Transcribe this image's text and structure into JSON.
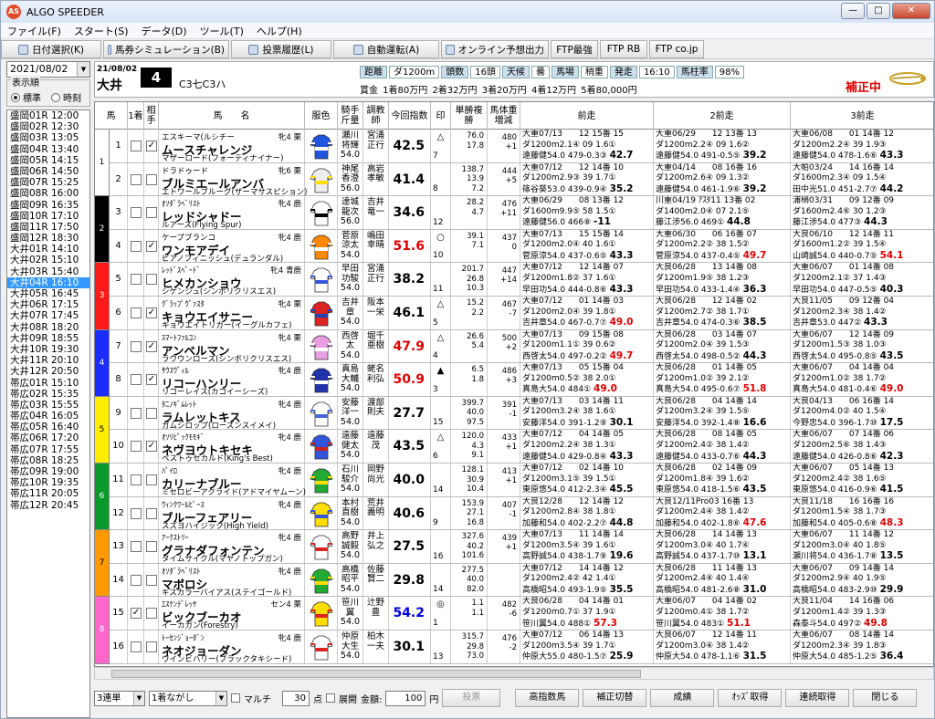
{
  "window": {
    "title": "ALGO SPEEDER",
    "icon_text": "AS"
  },
  "menu": [
    "ファイル(F)",
    "スタート(S)",
    "データ(D)",
    "ツール(T)",
    "ヘルプ(H)"
  ],
  "toolbar": [
    "日付選択(K)",
    "馬券シミュレーション(B)",
    "投票履歴(L)",
    "自動運転(A)",
    "オンライン予想出力",
    "FTP最強",
    "FTP RB",
    "FTP co.jp"
  ],
  "left": {
    "date": "2021/08/02",
    "order_label": "表示順",
    "radio_std": "標準",
    "radio_time": "時刻",
    "races": [
      "盛岡01R 12:00",
      "盛岡02R 12:30",
      "盛岡03R 13:05",
      "盛岡04R 13:40",
      "盛岡05R 14:15",
      "盛岡06R 14:50",
      "盛岡07R 15:25",
      "盛岡08R 16:00",
      "盛岡09R 16:35",
      "盛岡10R 17:10",
      "盛岡11R 17:50",
      "盛岡12R 18:30",
      "大井01R 14:10",
      "大井02R 15:10",
      "大井03R 15:40",
      "大井04R 16:10",
      "大井05R 16:45",
      "大井06R 17:15",
      "大井07R 17:45",
      "大井08R 18:20",
      "大井09R 18:55",
      "大井10R 19:30",
      "大井11R 20:10",
      "大井12R 20:50",
      "帯広01R 15:10",
      "帯広02R 15:35",
      "帯広03R 15:55",
      "帯広04R 16:05",
      "帯広05R 16:40",
      "帯広06R 17:20",
      "帯広07R 17:55",
      "帯広08R 18:25",
      "帯広09R 19:00",
      "帯広10R 19:35",
      "帯広11R 20:05",
      "帯広12R 20:45"
    ],
    "selected_index": 15
  },
  "race": {
    "date": "21/08/02",
    "place": "大井",
    "number": "4",
    "class": "C3七C3ハ",
    "info": [
      [
        "距離",
        "ダ1200m"
      ],
      [
        "頭数",
        "16頭"
      ],
      [
        "天候",
        "曇"
      ],
      [
        "馬場",
        "稍重"
      ],
      [
        "発走",
        "16:10"
      ],
      [
        "馬柱率",
        "98%"
      ]
    ],
    "prize": "賞金 1着80万円 2着32万円 3着20万円 4着12万円 5着80,000円",
    "correction": "補正中"
  },
  "columns": [
    "馬",
    "1着",
    "相手",
    "馬　　名",
    "服色",
    "騎手斤量",
    "調教師",
    "今回指数",
    "印",
    "単勝複勝",
    "馬体重増減",
    "前走",
    "2前走",
    "3前走"
  ],
  "horses": [
    {
      "no": "1",
      "win": false,
      "mate": true,
      "pre": "エスキーマ(ルシチー",
      "sx": "牝4 栗",
      "name": "ムースチャレンジ",
      "dam": "マザーロード(フォーティナイナー)",
      "jockey": "瀬川\n将輝\n54.0",
      "trainer": "宮涌\n正行",
      "index": "42.5",
      "ic": "",
      "mark": "△",
      "mark2": "7",
      "odds": "76.0\n17.8",
      "wt": "480\n+1",
      "p1": [
        "大重07/13　　12 15番 15",
        "ダ1200m2.1④ 09 1.6①",
        "遠藤健54.0 479-0.3③ 42.7"
      ],
      "p2": [
        "大重06/29　　12 13番 13",
        "ダ1200m2.2④ 09 1.6②",
        "遠藤健54.0 491-0.5⑤ 39.2"
      ],
      "p3": [
        "大重06/08　　01 14番 12",
        "ダ1200m2.2④ 39 1.9③",
        "遠藤健54.0 478-1.6⑥ 43.3"
      ]
    },
    {
      "no": "2",
      "win": false,
      "mate": false,
      "pre": "ドラドゥード",
      "sx": "牝6 栗",
      "name": "ブルミエールアンバ",
      "dam": "エトワールブルーグ(ザーマサスピション)",
      "jockey": "神尾\n香澄\n56.0",
      "trainer": "高岩\n孝敏",
      "index": "41.4",
      "ic": "",
      "mark": "",
      "mark2": "8",
      "odds": "138.7\n13.9\n7.2",
      "wt": "444\n+5",
      "p1": [
        "大重07/12　　12 14番 10",
        "ダ1200m2.9③ 39 1.7①",
        "篠谷葵53.0 439-0.9④ 35.2"
      ],
      "p2": [
        "大重04/14　　08 16番 16",
        "ダ1200m2.6④ 09 1.3②",
        "遠藤健54.0 461-1.9⑥ 39.2"
      ],
      "p3": [
        "大帕03/24　　14 16番 14",
        "ダ1600m2.3④ 09 1.5④",
        "田中光51.0 451-2.7⑦ 44.2"
      ]
    },
    {
      "no": "3",
      "win": false,
      "mate": false,
      "pre": "ｵｿﾀﾞﾗﾍﾞﾘｽﾄ",
      "sx": "牝4 鹿",
      "name": "レッドシャドー",
      "dam": "ルアーズ(Flying Spur)",
      "jockey": "達城\n龍次\n56.0",
      "trainer": "吉井\n竜一",
      "index": "34.6",
      "ic": "",
      "mark": "",
      "mark2": "12",
      "odds": "28.2\n4.7",
      "wt": "476\n+11",
      "p1": [
        "大重06/29　　08 13番 12",
        "ダ1600m9.9⑤ 58 1.5①",
        "遠藤健56.0 466⑧ -11"
      ],
      "p2": [
        "川重04/19 ｱｽﾀ11 13番 02",
        "ダ1400m2.0④ 07 2.1⑤",
        "藤江渉56.0 469① 44.8"
      ],
      "p3": [
        "浦稍03/31　　09 12番 09",
        "ダ1600m2.4⑥ 30 1.2③",
        "藤江渉54.0 477③ 44.3"
      ]
    },
    {
      "no": "4",
      "win": false,
      "mate": true,
      "pre": "ケープブランコ",
      "sx": "牝4 鹿",
      "name": "ワンモアデイ",
      "dam": "ビアノフィニッシュ(デュランダル)",
      "jockey": "菅原\n涼太\n54.0",
      "trainer": "嶋田\n幸晴",
      "index": "51.6",
      "ic": "red",
      "mark": "○",
      "mark2": "10",
      "odds": "39.1\n7.1",
      "wt": "437\n0",
      "p1": [
        "大重07/13　　15 15番 14",
        "ダ1200m2.0④ 40 1.6①",
        "菅原涼54.0 437-0.6⑤ 43.3"
      ],
      "p2": [
        "大重06/30　　06 16番 07",
        "ダ1200m2.2② 38 1.5②",
        "菅原涼54.0 437-0.4⑤ 49.7"
      ],
      "p3": [
        "大良06/10　　12 14番 11",
        "ダ1600m1.2② 39 1.5④",
        "山崎誠54.0 440-0.7⑤ 54.1"
      ]
    },
    {
      "no": "5",
      "win": false,
      "mate": false,
      "pre": "ﾚｯﾄﾞｽﾍﾟｰﾄﾞ",
      "sx": "牝4 青鹿",
      "name": "ヒメカンショウ",
      "dam": "シゲンジュ(シンボリクリスエス)",
      "jockey": "早田\n功駿\n54.0",
      "trainer": "宮涌\n正行",
      "index": "38.2",
      "ic": "",
      "mark": "",
      "mark2": "11",
      "odds": "201.7\n26.8\n10.3",
      "wt": "447\n+14",
      "p1": [
        "大重07/12　　12 14番 07",
        "ダ1200m1.8② 37 1.6①",
        "早田功54.0 444-0.8⑥ 43.3"
      ],
      "p2": [
        "大良06/28　　13 14番 08",
        "ダ1200m1.9⑤ 38 1.2③",
        "早田功54.0 433-1.4④ 36.3"
      ],
      "p3": [
        "大重06/07　　01 14番 08",
        "ダ1200m2.1② 37 1.4③",
        "早田功54.0 447-0.5⑤ 40.3"
      ]
    },
    {
      "no": "6",
      "win": false,
      "mate": true,
      "pre": "ｸﾞﾗｯﾌﾟｳﾞｧｽﾀ",
      "sx": "牝4 栗",
      "name": "キョウエイサニー",
      "dam": "キョウエイトリガー(イーグルカフェ)",
      "jockey": "吉井\n章\n54.0",
      "trainer": "阪本\n一栄",
      "index": "46.1",
      "ic": "",
      "mark": "△",
      "mark2": "5",
      "odds": "15.2\n2.2",
      "wt": "467\n-7",
      "p1": [
        "大重07/12　　01 14番 03",
        "ダ1200m2.0④ 39 1.8①",
        "吉井章54.0 467-0.7⑦ 49.0"
      ],
      "p2": [
        "大良06/28　　12 14番 02",
        "ダ1200m2.7② 38 1.7①",
        "吉井章54.0 474-0.3⑥ 38.5"
      ],
      "p3": [
        "大良11/05　　09 12番 04",
        "ダ1200m2.3④ 38 1.4②",
        "吉井章53.0 447② 43.3"
      ]
    },
    {
      "no": "7",
      "win": false,
      "mate": true,
      "pre": "ｽﾏｰﾄﾌｧﾙｺﾝ",
      "sx": "牝4 栗",
      "name": "アンベルマン",
      "dam": "ラウウンローズ(シンボリクリスエス)",
      "jockey": "西啓\n太\n54.0",
      "trainer": "堀千\n亜樹",
      "index": "47.9",
      "ic": "red",
      "mark": "△",
      "mark2": "4",
      "odds": "26.6\n5.4",
      "wt": "500\n+2",
      "p1": [
        "大重07/13　　09 15番 08",
        "ダ1200m1.1① 39 0.6②",
        "西啓太54.0 497-0.2② 49.7"
      ],
      "p2": [
        "大良06/28　　03 14番 07",
        "ダ1200m2.0④ 39 1.5③",
        "西啓太54.0 498-0.5② 44.3"
      ],
      "p3": [
        "大重06/07　　12 14番 09",
        "ダ1200m1.5③ 38 1.0③",
        "西啓太54.0 495-0.8⑤ 43.5"
      ]
    },
    {
      "no": "8",
      "win": false,
      "mate": true,
      "pre": "ｻｳｽｳﾞｨﾙ",
      "sx": "牝4 鹿",
      "name": "リコーハンリー",
      "dam": "リコーレイス(カコイーシーズ)",
      "jockey": "真島\n大輔\n54.0",
      "trainer": "蛯名\n利弘",
      "index": "50.9",
      "ic": "red",
      "mark": "▲",
      "mark2": "3",
      "odds": "6.5\n1.8",
      "wt": "486\n+3",
      "p1": [
        "大重07/13　　05 15番 04",
        "ダ1200m0.5② 38 2.0①",
        "真島大54.0 484① 49.0"
      ],
      "p2": [
        "大良06/28　　01 14番 05",
        "ダ1200m1.0② 39 2.1②",
        "真島大54.0 495-0.6⑦ 51.8"
      ],
      "p3": [
        "大重06/07　　04 14番 04",
        "ダ1200m1.0② 38 1.7②",
        "真島大54.0 481-0.4⑥ 49.0"
      ]
    },
    {
      "no": "9",
      "win": false,
      "mate": false,
      "pre": "ﾀﾆﾉｷﾞﾑﾚｯﾄ",
      "sx": "牝4 鹿",
      "name": "ラムレットキス",
      "dam": "ガムシロップ(ローズンスイメイ)",
      "jockey": "安藤\n洋一\n54.0",
      "trainer": "渡部\n則夫",
      "index": "27.7",
      "ic": "",
      "mark": "",
      "mark2": "15",
      "odds": "399.7\n40.0\n97.5",
      "wt": "391\n-1",
      "p1": [
        "大重07/13　　03 14番 11",
        "ダ1200m3.2④ 38 1.6①",
        "安藤洋54.0 391-1.2⑨ 30.1"
      ],
      "p2": [
        "大良06/28　　04 14番 14",
        "ダ1200m3.2④ 39 1.5⑤",
        "安藤洋54.0 392-1.4⑧ 16.6"
      ],
      "p3": [
        "大良04/13　　06 16番 14",
        "ダ1200m4.0② 40 1.5④",
        "今野忠54.0 396-1.7⑩ 17.5"
      ]
    },
    {
      "no": "10",
      "win": false,
      "mate": true,
      "pre": "ｵｿﾘﾋﾟｯｸﾓﾓｷﾞ",
      "sx": "牝4 鹿",
      "name": "ネヴヨウトキセキ",
      "dam": "ベストゥセカルド(King's Best)",
      "jockey": "遠藤\n健太\n54.0",
      "trainer": "遠藤\n茂",
      "index": "43.5",
      "ic": "",
      "mark": "△",
      "mark2": "6",
      "odds": "120.0\n4.3\n9.1",
      "wt": "433\n+1",
      "p1": [
        "大重07/12　　04 14番 05",
        "ダ1200m2.2④ 38 1.3①",
        "遠藤健54.0 429-0.8④ 43.3"
      ],
      "p2": [
        "大良06/28　　08 14番 05",
        "ダ1200m2.4② 38 1.4②",
        "遠藤健54.0 433-0.7⑥ 44.3"
      ],
      "p3": [
        "大重06/07　　07 14番 06",
        "ダ1200m2.5⑥ 38 1.4③",
        "遠藤健54.0 426-0.8⑥ 42.3"
      ]
    },
    {
      "no": "11",
      "win": false,
      "mate": false,
      "pre": "ﾊﾟｲﾛ",
      "sx": "牝4 鹿",
      "name": "カリーナブルー",
      "dam": "ミセロビーアクライド(アドマイヤムーン)",
      "jockey": "石川\n駿介\n54.0",
      "trainer": "岡野\n尚光",
      "index": "40.0",
      "ic": "",
      "mark": "",
      "mark2": "14",
      "odds": "128.1\n30.9\n10.4",
      "wt": "413\n+1",
      "p1": [
        "大重07/12　　02 14番 10",
        "ダ1200m3.1⑤ 39 1.5①",
        "東原悠54.0 412-2.3④ 45.5"
      ],
      "p2": [
        "大良06/28　　02 14番 09",
        "ダ1200m1.8④ 39 1.6②",
        "東原悠54.0 418-1.5⑥ 43.5"
      ],
      "p3": [
        "大重06/07　　05 14番 13",
        "ダ1200m2.4② 38 1.6⑤",
        "東原悠54.0 416-0.9⑥ 41.5"
      ]
    },
    {
      "no": "12",
      "win": false,
      "mate": false,
      "pre": "ｳｨﾝｸﾜｰﾙﾋﾟｰｽ",
      "sx": "牝4 鹿",
      "name": "ブルーフェアリー",
      "dam": "スズヨハイジック(High Yield)",
      "jockey": "本村\n直樹\n54.0",
      "trainer": "荒井\n義明",
      "index": "40.6",
      "ic": "",
      "mark": "",
      "mark2": "9",
      "odds": "153.9\n27.1\n16.8",
      "wt": "407\n-1",
      "p1": [
        "大良12/28　　12 14番 12",
        "ダ1200m2.8④ 38 1.8①",
        "加藤和54.0 402-2.2⑦ 44.8"
      ],
      "p2": [
        "大良12/11Pro03 16番 13",
        "ダ1200m2.4④ 38 1.4②",
        "加藤和54.0 402-1.8⑥ 47.6"
      ],
      "p3": [
        "大良11/18　　16 16番 16",
        "ダ1200m1.5④ 38 1.7③",
        "加藤和54.0 405-0.6⑧ 48.3"
      ]
    },
    {
      "no": "13",
      "win": false,
      "mate": false,
      "pre": "ｱｰｸｽﾄﾘｰ",
      "sx": "牝4 鹿",
      "name": "グラナダフォンテン",
      "dam": "タイムサイクル(マヤノトップガン)",
      "jockey": "高野\n誠毅\n54.0",
      "trainer": "井上\n弘之",
      "index": "27.5",
      "ic": "",
      "mark": "",
      "mark2": "16",
      "odds": "327.6\n40.2\n101.6",
      "wt": "439\n+1",
      "p1": [
        "大重07/13　　11 14番 14",
        "ダ1200m3.5④ 39 1.6①",
        "高野誠54.0 438-1.7⑨ 19.6"
      ],
      "p2": [
        "大良06/28　　14 14番 13",
        "ダ1200m3.0④ 40 1.7④",
        "高野誠54.0 437-1.7⑩ 13.1"
      ],
      "p3": [
        "大重06/07　　11 14番 12",
        "ダ1200m3.0④ 40 1.8⑤",
        "瀬川将54.0 436-1.7⑧ 13.5"
      ]
    },
    {
      "no": "14",
      "win": false,
      "mate": false,
      "pre": "ｵｿﾀﾞﾗﾍﾞﾘｽﾄ",
      "sx": "牝4 鹿",
      "name": "マボロシ",
      "dam": "キスカラーバイアス(ステイゴールド)",
      "jockey": "高橋\n昭平\n54.0",
      "trainer": "佐藤\n賢二",
      "index": "29.8",
      "ic": "",
      "mark": "",
      "mark2": "14",
      "odds": "277.5\n40.0\n82.0",
      "wt": "",
      "p1": [
        "大重07/12　　14 14番 12",
        "ダ1200m2.4② 42 1.4①",
        "高橋昭54.0 493-1.9⑤ 35.5"
      ],
      "p2": [
        "大良06/28　　11 14番 13",
        "ダ1200m2.4④ 40 1.4④",
        "高橋昭54.0 481-2.6⑧ 31.0"
      ],
      "p3": [
        "大重06/07　　09 14番 14",
        "ダ1200m2.9④ 40 1.9⑤",
        "高橋昭54.0 483-2.9⑩ 29.9"
      ]
    },
    {
      "no": "15",
      "win": true,
      "mate": false,
      "pre": "ｴｽｹﾝﾃﾞﾚｯﾔ",
      "sx": "セン4 栗",
      "name": "ビックブーカオ",
      "dam": "イーカガン(Forestry)",
      "jockey": "笹川\n翼\n54.0",
      "trainer": "辻野\n豊",
      "index": "54.2",
      "ic": "blue",
      "mark": "◎",
      "mark2": "1",
      "odds": "1.1\n1.1",
      "wt": "482\n-6",
      "p1": [
        "大良06/28　　04 14番 01",
        "ダ1200m0.7① 37 1.9①",
        "笹川翼54.0 488① 57.3"
      ],
      "p2": [
        "大重06/07　　04 14番 02",
        "ダ1200m0.4① 38 1.7②",
        "笹川翼54.0 483① 51.1"
      ],
      "p3": [
        "大良11/04　　14 16番 06",
        "ダ1200m1.4② 39 1.3③",
        "森泰斗54.0 497② 49.8"
      ]
    },
    {
      "no": "16",
      "win": false,
      "mate": false,
      "pre": "ﾄｰｾﾝｼﾞｮｰﾀﾞﾝ",
      "sx": "牝4 鹿",
      "name": "ネオジョーダン",
      "dam": "ウインビハリー(ブラックタキシード)",
      "jockey": "仲原\n大生\n54.0",
      "trainer": "柏木\n一夫",
      "index": "30.1",
      "ic": "",
      "mark": "",
      "mark2": "13",
      "odds": "315.7\n29.8\n73.0",
      "wt": "476\n-2",
      "p1": [
        "大重07/12　　06 14番 13",
        "ダ1200m3.5④ 39 1.7①",
        "仲原大55.0 480-1.5⑦ 25.9"
      ],
      "p2": [
        "大良06/07　　12 14番 11",
        "ダ1200m3.0④ 38 1.4②",
        "仲原大54.0 478-1.1⑥ 31.5"
      ],
      "p3": [
        "大重06/07　　08 14番 14",
        "ダ1200m2.3④ 39 1.8③",
        "仲原大54.0 485-1.2⑤ 36.4"
      ]
    }
  ],
  "frames": [
    {
      "label": "1",
      "color": "#ffffff",
      "text": "#000"
    },
    {
      "label": "2",
      "color": "#000000",
      "text": "#fff"
    },
    {
      "label": "3",
      "color": "#ff1a1a",
      "text": "#fff"
    },
    {
      "label": "4",
      "color": "#1a2cff",
      "text": "#fff"
    },
    {
      "label": "5",
      "color": "#ffee00",
      "text": "#000"
    },
    {
      "label": "6",
      "color": "#0a9a2a",
      "text": "#fff"
    },
    {
      "label": "7",
      "color": "#ff9900",
      "text": "#000"
    },
    {
      "label": "8",
      "color": "#ff66cc",
      "text": "#fff"
    }
  ],
  "bottom": {
    "bet_type": "3連単",
    "method": "1着ながし",
    "multi": "マルチ",
    "points": "30",
    "points_unit": "点",
    "expand": "展開",
    "amount_label": "金額:",
    "amount": "100",
    "yen": "円",
    "vote": "投票",
    "buttons": [
      "高指数馬",
      "補正切替",
      "成績",
      "ｵｯｽﾞ取得",
      "連続取得",
      "閉じる"
    ]
  }
}
